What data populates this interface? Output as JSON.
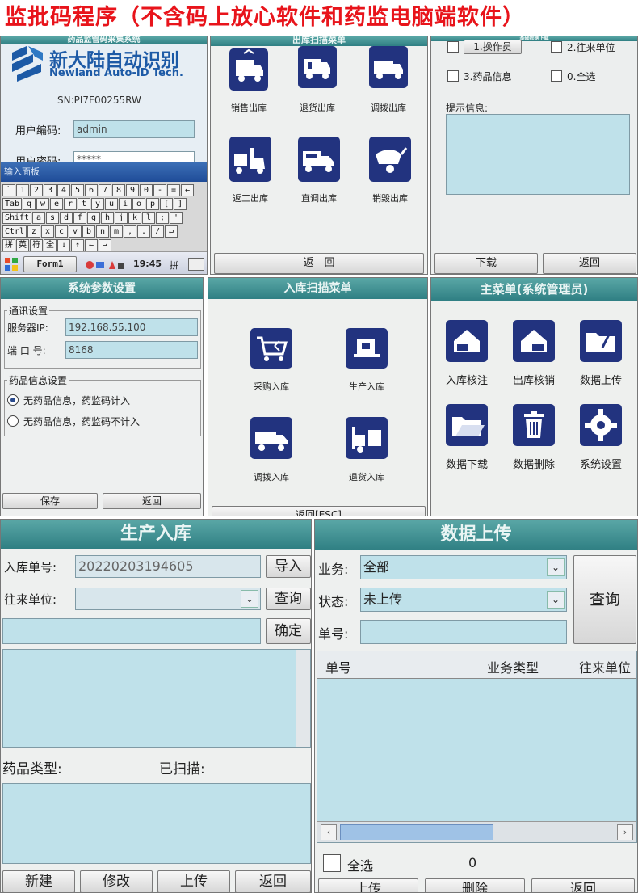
{
  "page_title": "监批码程序（不含码上放心软件和药监电脑端软件）",
  "login": {
    "header": "药品监管码采集系统",
    "logo_cn": "新大陆自动识别",
    "logo_en": "Newland Auto-ID Tech.",
    "sn": "SN:PI7F00255RW",
    "user_label": "用户编码:",
    "user_value": "admin",
    "pwd_label": "用户密码:",
    "pwd_value": "*****",
    "kb_title": "输入面板",
    "kb_rows": [
      [
        "`",
        "1",
        "2",
        "3",
        "4",
        "5",
        "6",
        "7",
        "8",
        "9",
        "0",
        "-",
        "=",
        "←"
      ],
      [
        "Tab",
        "q",
        "w",
        "e",
        "r",
        "t",
        "y",
        "u",
        "i",
        "o",
        "p",
        "[",
        "]"
      ],
      [
        "Shift",
        "a",
        "s",
        "d",
        "f",
        "g",
        "h",
        "j",
        "k",
        "l",
        ";",
        "'"
      ],
      [
        "Ctrl",
        "z",
        "x",
        "c",
        "v",
        "b",
        "n",
        "m",
        ",",
        ".",
        "/",
        "↵"
      ],
      [
        "拼",
        "英",
        "符",
        "全",
        "↓",
        "↑",
        "←",
        "→"
      ]
    ],
    "taskbar_app": "Form1",
    "taskbar_time": "19:45",
    "taskbar_ime": "拼"
  },
  "outbound": {
    "header": "出库扫描菜单",
    "items": [
      "销售出库",
      "退货出库",
      "调拨出库",
      "返工出库",
      "直调出库",
      "销毁出库"
    ],
    "back_label": "返　回"
  },
  "download": {
    "header": "基础数据下载",
    "options": [
      "1.操作员",
      "2.往来单位",
      "3.药品信息",
      "0.全选"
    ],
    "prompt_label": "提示信息:",
    "download_label": "下载",
    "back_label": "返回"
  },
  "settings": {
    "header": "系统参数设置",
    "comm_group": "通讯设置",
    "ip_label": "服务器IP:",
    "ip_value": "192.168.55.100",
    "port_label": "端  口  号:",
    "port_value": "8168",
    "drug_group": "药品信息设置",
    "radio1": "无药品信息，药监码计入",
    "radio2": "无药品信息，药监码不计入",
    "save_label": "保存",
    "back_label": "返回"
  },
  "inbound": {
    "header": "入库扫描菜单",
    "items": [
      "采购入库",
      "生产入库",
      "调拨入库",
      "退货入库"
    ],
    "back_label": "返回[ESC]"
  },
  "main_menu": {
    "header": "主菜单(系统管理员)",
    "items": [
      "入库核注",
      "出库核销",
      "数据上传",
      "数据下载",
      "数据删除",
      "系统设置"
    ]
  },
  "production": {
    "header": "生产入库",
    "order_label": "入库单号:",
    "order_value": "20220203194605",
    "partner_label": "往来单位:",
    "import_label": "导入",
    "query_label": "查询",
    "confirm_label": "确定",
    "drug_type_label": "药品类型:",
    "scanned_label": "已扫描:",
    "buttons": [
      "新建",
      "修改",
      "上传",
      "返回"
    ]
  },
  "upload": {
    "header": "数据上传",
    "biz_label": "业务:",
    "biz_value": "全部",
    "status_label": "状态:",
    "status_value": "未上传",
    "order_label": "单号:",
    "query_label": "查询",
    "columns": [
      "单号",
      "业务类型",
      "往来单位"
    ],
    "select_all_label": "全选",
    "count": "0",
    "buttons": [
      "上传",
      "删除",
      "返回"
    ]
  },
  "colors": {
    "title_red": "#e8141b",
    "header_teal": "#3f8f92",
    "tile_navy": "#22337f",
    "field_blue": "#bfe1ea"
  }
}
